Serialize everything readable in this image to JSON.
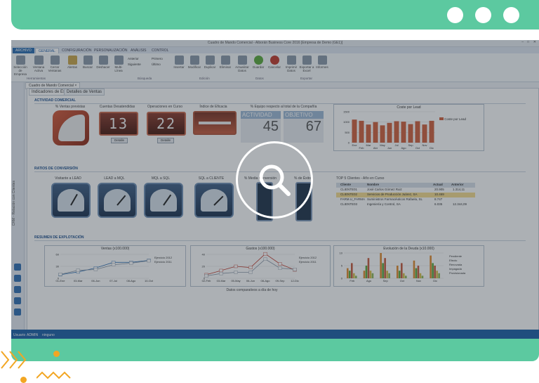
{
  "window": {
    "title": "Cuadro de Mando Comercial - Alborán Business Core 2016 [Empresa de Demo (GE1)]",
    "ribbon_tabs": [
      "ARCHIVO",
      "GENERAL",
      "CONFIGURACIÓN",
      "PERSONALIZACIÓN",
      "ANÁLISIS",
      "CONTROL"
    ],
    "ribbon_buttons": [
      "Selección de Empresa",
      "Ventana Activa",
      "Cerrar Ventanas",
      "Alertas",
      "Buscar",
      "Deshacer",
      "Multi-Línea",
      "Anterior",
      "Siguiente",
      "Primero",
      "Último",
      "Insertar",
      "Modificar",
      "Duplicar",
      "Eliminar",
      "Actualizar Datos",
      "Guardar",
      "Cancelar",
      "Imprimir Datos",
      "Exportar a Excel",
      "Informes"
    ],
    "ribbon_groups": [
      "Herramientas",
      "Búsqueda",
      "Edición",
      "Datos",
      "Exportar"
    ],
    "doc_tab": "Cuadro de Mando Comercial",
    "side_title": "CRM - Relación con Clientes",
    "subtabs": [
      "Indicadores de Estado",
      "Detalles de Ventas"
    ],
    "status": {
      "user_label": "Usuario",
      "user": "ADMIN",
      "role_label": "ninguno"
    }
  },
  "sections": {
    "actividad": "ACTIVIDAD COMERCIAL",
    "ratios": "RATIOS DE CONVERSIÓN",
    "resumen": "RESUMEN DE EXPLOTACIÓN"
  },
  "actividad": {
    "ventas_label": "% Ventas previstas",
    "quotes_label": "Cuentas Desatendidas",
    "quotes_value": "13",
    "ops_label": "Operaciones en Curso",
    "ops_value": "22",
    "detalle": "Detalle",
    "eficacia_label": "Índice de Eficacia",
    "equipo_label": "% Equipo respecto al total de la Compañía",
    "actividad_head": "ACTIVIDAD",
    "actividad_value": "45",
    "objetivo_head": "OBJETIVO",
    "objetivo_value": "67"
  },
  "coste_chart": {
    "title": "Coste por Lead",
    "legend": "Coste por Lead",
    "color": "#d0603c"
  },
  "ratios": {
    "gauges": [
      "Visitante a LEAD",
      "LEAD a MQL",
      "MQL a SQL",
      "SQL a CLIENTE",
      "% Media Conversión",
      "% de Éxito"
    ]
  },
  "top5": {
    "title": "TOP 5 Clientes - Año en Curso",
    "headers": [
      "Cliente",
      "Nombre",
      "Actual",
      "Anterior"
    ],
    "rows": [
      {
        "code": "CLIENTE01",
        "name": "José Carlos Gómez Ruiz",
        "actual": "20.905",
        "anterior": "1.314,11"
      },
      {
        "code": "CLIENTE02",
        "name": "Servicios de Producción Juárez, SA",
        "actual": "10.469",
        "anterior": ""
      },
      {
        "code": "FARM.U_FARMA",
        "name": "Suministros Farmacéuticos Rafaela, SL",
        "actual": "8.747",
        "anterior": ""
      },
      {
        "code": "CLIENTE03",
        "name": "Ingeniería y Control, SA",
        "actual": "6.035",
        "anterior": "12.344,09"
      }
    ]
  },
  "ventas_chart": {
    "title": "Ventas (x100.000)",
    "legend": [
      "Ejercicio 2012",
      "Ejercicio 2011"
    ]
  },
  "gastos_chart": {
    "title": "Gastos (x100.000)",
    "legend": [
      "Ejercicio 2012",
      "Ejercicio 2011"
    ]
  },
  "deuda_chart": {
    "title": "Evolución de la Deuda (x10.000)",
    "legend": [
      "Pendiente",
      "Efecto",
      "Renovada",
      "Impagada",
      "Provisionada"
    ]
  },
  "footer_note": "Datos comparativos a día de hoy",
  "chart_data": [
    {
      "type": "bar",
      "title": "Coste por Lead",
      "categories": [
        "Ene",
        "Feb",
        "Mar",
        "Abr",
        "May",
        "Jun",
        "Jul",
        "Ago",
        "Sep",
        "Oct",
        "Nov",
        "Dic"
      ],
      "series": [
        {
          "name": "Coste por Lead",
          "values": [
            1120,
            1060,
            880,
            1000,
            840,
            960,
            1040,
            1020,
            900,
            1040,
            880,
            1060
          ]
        }
      ],
      "ylim": [
        0,
        1500
      ]
    },
    {
      "type": "line",
      "title": "Ventas (x100.000)",
      "categories": [
        "01-Ene",
        "03-Mar",
        "06-Jun",
        "07-Jul",
        "08-Ago",
        "10-Oct"
      ],
      "series": [
        {
          "name": "Ejercicio 2012",
          "values": [
            9,
            16,
            26,
            40,
            40,
            45
          ]
        },
        {
          "name": "Ejercicio 2011",
          "values": [
            10,
            20,
            22,
            34,
            38,
            44
          ]
        }
      ],
      "ylim": [
        0,
        60
      ]
    },
    {
      "type": "line",
      "title": "Gastos (x100.000)",
      "categories": [
        "02-Feb",
        "03-Mar",
        "05-May",
        "06-Jun",
        "08-Ago",
        "09-Sep",
        "12-Dic"
      ],
      "series": [
        {
          "name": "Ejercicio 2012",
          "values": [
            6,
            13,
            20,
            18,
            41,
            24,
            14
          ]
        },
        {
          "name": "Ejercicio 2011",
          "values": [
            4,
            8,
            10,
            10,
            32,
            17,
            15
          ]
        }
      ],
      "ylim": [
        0,
        40
      ]
    },
    {
      "type": "bar",
      "title": "Evolución de la Deuda (x10.000)",
      "categories": [
        "Feb",
        "Ago",
        "Sep",
        "Oct",
        "Nov",
        "Dic"
      ],
      "series": [
        {
          "name": "Pendiente",
          "values": [
            4,
            3,
            10,
            5,
            7,
            9
          ]
        },
        {
          "name": "Efecto",
          "values": [
            3,
            5,
            6,
            3,
            4,
            6
          ]
        },
        {
          "name": "Renovada",
          "values": [
            6,
            8,
            8,
            6,
            5,
            5
          ]
        },
        {
          "name": "Impagada",
          "values": [
            2,
            3,
            3,
            2,
            2,
            3
          ]
        },
        {
          "name": "Provisionada",
          "values": [
            1,
            2,
            2,
            1,
            1,
            2
          ]
        }
      ],
      "ylim": [
        0,
        10
      ]
    }
  ]
}
